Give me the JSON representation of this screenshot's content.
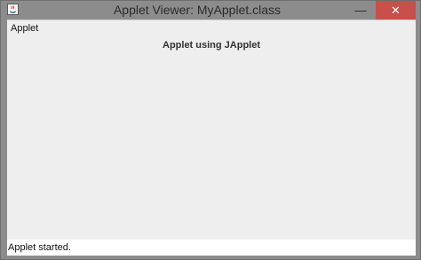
{
  "window": {
    "title": "Applet Viewer: MyApplet.class",
    "minimize_glyph": "—",
    "close_glyph": "✕",
    "icons": {
      "app": "java-cup-icon",
      "minimize": "minimize-icon",
      "close": "close-icon"
    },
    "colors": {
      "titlebar": "#8c8c8c",
      "close_button": "#c7504a"
    }
  },
  "menu": {
    "label": "Applet"
  },
  "applet": {
    "heading": "Applet using JApplet"
  },
  "status": {
    "text": "Applet started."
  }
}
